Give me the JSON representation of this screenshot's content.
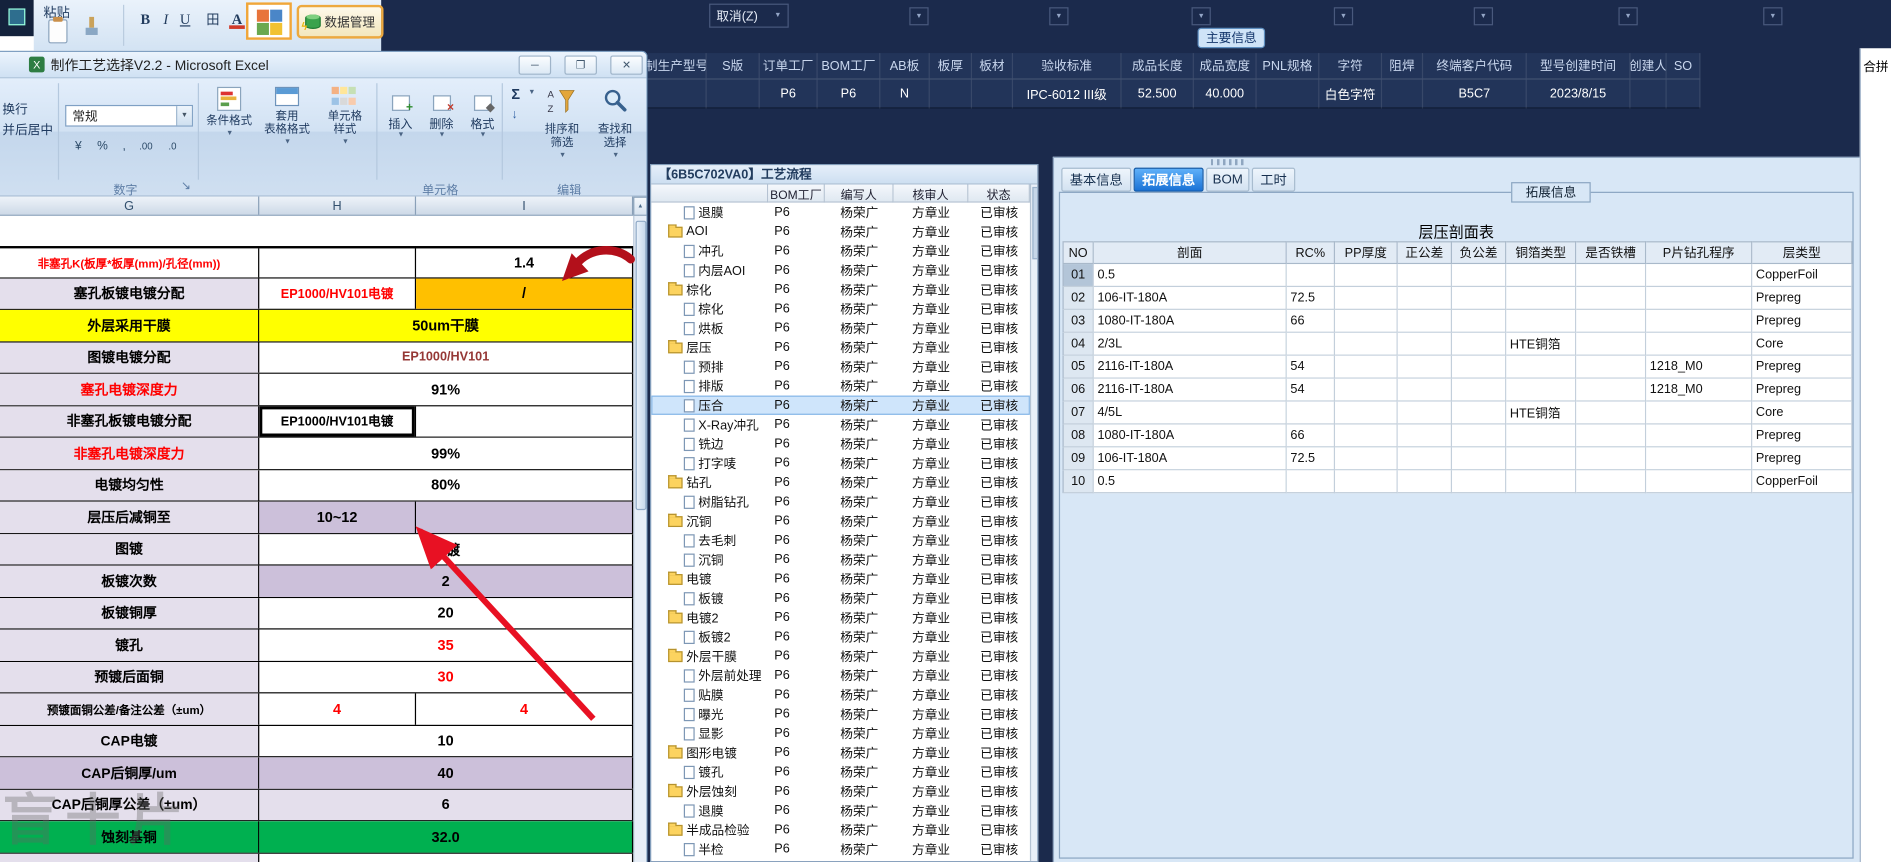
{
  "top_bar": {
    "paste": "粘贴",
    "bold": "B",
    "italic": "I",
    "underline": "U",
    "borders_icon": "田",
    "font_color_letter": "A",
    "data_management": "数据管理",
    "cancel_menu": "取消(Z)"
  },
  "header": {
    "tag": "主要信息",
    "merge_label": "合拼",
    "columns": [
      {
        "label": "制生产型号",
        "value": ""
      },
      {
        "label": "S版",
        "value": ""
      },
      {
        "label": "订单工厂",
        "value": "P6"
      },
      {
        "label": "BOM工厂",
        "value": "P6"
      },
      {
        "label": "AB板",
        "value": "N"
      },
      {
        "label": "板厚",
        "value": ""
      },
      {
        "label": "板材",
        "value": ""
      },
      {
        "label": "验收标准",
        "value": "IPC-6012 III级"
      },
      {
        "label": "成品长度",
        "value": "52.500"
      },
      {
        "label": "成品宽度",
        "value": "40.000"
      },
      {
        "label": "PNL规格",
        "value": ""
      },
      {
        "label": "字符",
        "value": "白色字符"
      },
      {
        "label": "阻焊",
        "value": ""
      },
      {
        "label": "终端客户代码",
        "value": "B5C7"
      },
      {
        "label": "型号创建时间",
        "value": "2023/8/15"
      },
      {
        "label": "创建人",
        "value": ""
      },
      {
        "label": "SO",
        "value": ""
      }
    ]
  },
  "excel": {
    "title": "制作工艺选择V2.2 - Microsoft Excel",
    "window_controls": {
      "min": "─",
      "max": "❐",
      "close": "✕",
      "help": "?"
    },
    "ribbon": {
      "wrap_fragment": "换行",
      "merge_center_fragment": "并后居中",
      "number_format_value": "常规",
      "number_buttons": [
        "¥",
        "%",
        ",",
        ".00",
        ".0"
      ],
      "number_group": "数字",
      "conditional_format": "条件格式",
      "format_as_table": [
        "套用",
        "表格格式"
      ],
      "cell_styles": [
        "单元格",
        "样式"
      ],
      "styles_group": "样式",
      "insert": "插入",
      "delete_label": "删除",
      "format_label": "格式",
      "cells_group": "单元格",
      "autosum": "Σ",
      "sort_filter": [
        "排序和",
        "筛选"
      ],
      "find_select": [
        "查找和",
        "选择"
      ],
      "edit_group": "编辑"
    },
    "sheet": {
      "col_headers": [
        "G",
        "H",
        "I"
      ],
      "rows": [
        {
          "label": "非塞孔K(板厚*板厚(mm)/孔径(mm))",
          "label_bg": "#ffffff",
          "label_color": "#ff0000",
          "label_small": true,
          "cells": [
            {
              "col": "H",
              "text": ""
            },
            {
              "col": "I",
              "text": "1.4"
            }
          ]
        },
        {
          "label": "塞孔板镀电镀分配",
          "label_bg": "#e4dfec",
          "cells": [
            {
              "col": "H",
              "text": "EP1000/HV101电镀",
              "color": "#ff0000"
            },
            {
              "col": "I",
              "text": "/",
              "bg": "#ffc000"
            }
          ]
        },
        {
          "label": "外层采用干膜",
          "label_bg": "#ffff00",
          "cells": [
            {
              "col": "HI",
              "text": "50um干膜",
              "bg": "#ffff00"
            }
          ]
        },
        {
          "label": "图镀电镀分配",
          "label_bg": "#e4dfec",
          "cells": [
            {
              "col": "HI",
              "text": "EP1000/HV101",
              "color": "#953735"
            }
          ]
        },
        {
          "label": "塞孔电镀深度力",
          "label_bg": "#e4dfec",
          "label_color": "#ff0000",
          "cells": [
            {
              "col": "HI",
              "text": "91%"
            }
          ]
        },
        {
          "label": "非塞孔板镀电镀分配",
          "label_bg": "#e4dfec",
          "cells": [
            {
              "col": "H",
              "text": "EP1000/HV101电镀",
              "selected": true
            },
            {
              "col": "I",
              "text": ""
            }
          ]
        },
        {
          "label": "非塞孔电镀深度力",
          "label_bg": "#e4dfec",
          "label_color": "#ff0000",
          "cells": [
            {
              "col": "HI",
              "text": "99%"
            }
          ]
        },
        {
          "label": "电镀均匀性",
          "label_bg": "#e4dfec",
          "cells": [
            {
              "col": "HI",
              "text": "80%"
            }
          ]
        },
        {
          "label": "层压后减铜至",
          "label_bg": "#e4dfec",
          "cells": [
            {
              "col": "H",
              "text": "10~12",
              "bg": "#ccc0da"
            },
            {
              "col": "I",
              "text": "",
              "bg": "#ccc0da"
            }
          ]
        },
        {
          "label": "图镀",
          "label_bg": "#e4dfec",
          "cells": [
            {
              "col": "HI",
              "text": "图镀"
            }
          ]
        },
        {
          "label": "板镀次数",
          "label_bg": "#e4dfec",
          "cells": [
            {
              "col": "HI",
              "text": "2",
              "bg": "#ccc0da"
            }
          ]
        },
        {
          "label": "板镀铜厚",
          "label_bg": "#e4dfec",
          "cells": [
            {
              "col": "HI",
              "text": "20"
            }
          ]
        },
        {
          "label": "镀孔",
          "label_bg": "#e4dfec",
          "cells": [
            {
              "col": "HI",
              "text": "35",
              "color": "#ff0000"
            }
          ]
        },
        {
          "label": "预镀后面铜",
          "label_bg": "#e4dfec",
          "cells": [
            {
              "col": "HI",
              "text": "30",
              "color": "#ff0000"
            }
          ]
        },
        {
          "label": "预镀面铜公差/备注公差（±um）",
          "label_bg": "#e4dfec",
          "label_small": true,
          "cells": [
            {
              "col": "H",
              "text": "4",
              "color": "#ff0000"
            },
            {
              "col": "I",
              "text": "4",
              "color": "#ff0000"
            }
          ]
        },
        {
          "label": "CAP电镀",
          "label_bg": "#e4dfec",
          "cells": [
            {
              "col": "HI",
              "text": "10"
            }
          ]
        },
        {
          "label": "CAP后铜厚/um",
          "label_bg": "#ccc0da",
          "cells": [
            {
              "col": "HI",
              "text": "40",
              "bg": "#ccc0da"
            }
          ]
        },
        {
          "label": "CAP后铜厚公差（±um）",
          "label_bg": "#e4dfec",
          "cells": [
            {
              "col": "HI",
              "text": "6",
              "bg": "#e4dfec"
            }
          ]
        },
        {
          "label": "蚀刻基铜",
          "label_bg": "#00b050",
          "cells": [
            {
              "col": "HI",
              "text": "32.0",
              "bg": "#00b050"
            }
          ]
        }
      ]
    }
  },
  "tree": {
    "title": "【6B5C702VA0】工艺流程",
    "headers": [
      "BOM工厂",
      "编写人",
      "核审人",
      "状态"
    ],
    "common": {
      "bom": "P6",
      "writer": "杨荣广",
      "reviewer": "方章业",
      "status": "已审核"
    },
    "items": [
      {
        "name": "退膜",
        "type": "leaf"
      },
      {
        "name": "AOI",
        "type": "folder"
      },
      {
        "name": "冲孔",
        "type": "leaf"
      },
      {
        "name": "内层AOI",
        "type": "leaf"
      },
      {
        "name": "棕化",
        "type": "folder"
      },
      {
        "name": "棕化",
        "type": "leaf"
      },
      {
        "name": "烘板",
        "type": "leaf"
      },
      {
        "name": "层压",
        "type": "folder"
      },
      {
        "name": "预排",
        "type": "leaf"
      },
      {
        "name": "排版",
        "type": "leaf"
      },
      {
        "name": "压合",
        "type": "leaf",
        "selected": true
      },
      {
        "name": "X-Ray冲孔",
        "type": "leaf"
      },
      {
        "name": "铣边",
        "type": "leaf"
      },
      {
        "name": "打字唛",
        "type": "leaf"
      },
      {
        "name": "钻孔",
        "type": "folder"
      },
      {
        "name": "树脂钻孔",
        "type": "leaf"
      },
      {
        "name": "沉铜",
        "type": "folder"
      },
      {
        "name": "去毛刺",
        "type": "leaf"
      },
      {
        "name": "沉铜",
        "type": "leaf"
      },
      {
        "name": "电镀",
        "type": "folder"
      },
      {
        "name": "板镀",
        "type": "leaf"
      },
      {
        "name": "电镀2",
        "type": "folder"
      },
      {
        "name": "板镀2",
        "type": "leaf"
      },
      {
        "name": "外层干膜",
        "type": "folder"
      },
      {
        "name": "外层前处理",
        "type": "leaf"
      },
      {
        "name": "贴膜",
        "type": "leaf"
      },
      {
        "name": "曝光",
        "type": "leaf"
      },
      {
        "name": "显影",
        "type": "leaf"
      },
      {
        "name": "图形电镀",
        "type": "folder"
      },
      {
        "name": "镀孔",
        "type": "leaf"
      },
      {
        "name": "外层蚀刻",
        "type": "folder"
      },
      {
        "name": "退膜",
        "type": "leaf"
      },
      {
        "name": "半成品检验",
        "type": "folder"
      },
      {
        "name": "半检",
        "type": "leaf"
      }
    ]
  },
  "panel": {
    "tabs": [
      "基本信息",
      "拓展信息",
      "BOM",
      "工时"
    ],
    "active_tab": 1,
    "group_label": "拓展信息",
    "table_title": "层压剖面表",
    "table": {
      "columns": [
        "NO",
        "剖面",
        "RC%",
        "PP厚度",
        "正公差",
        "负公差",
        "铜箔类型",
        "是否铁槽",
        "P片钻孔程序",
        "层类型"
      ],
      "rows": [
        [
          "01",
          "0.5",
          "",
          "",
          "",
          "",
          "",
          "",
          "",
          "CopperFoil"
        ],
        [
          "02",
          "106-IT-180A",
          "72.5",
          "",
          "",
          "",
          "",
          "",
          "",
          "Prepreg"
        ],
        [
          "03",
          "1080-IT-180A",
          "66",
          "",
          "",
          "",
          "",
          "",
          "",
          "Prepreg"
        ],
        [
          "04",
          "2/3L",
          "",
          "",
          "",
          "",
          "HTE铜箔",
          "",
          "",
          "Core"
        ],
        [
          "05",
          "2116-IT-180A",
          "54",
          "",
          "",
          "",
          "",
          "",
          "1218_M0",
          "Prepreg"
        ],
        [
          "06",
          "2116-IT-180A",
          "54",
          "",
          "",
          "",
          "",
          "",
          "1218_M0",
          "Prepreg"
        ],
        [
          "07",
          "4/5L",
          "",
          "",
          "",
          "",
          "HTE铜箔",
          "",
          "",
          "Core"
        ],
        [
          "08",
          "1080-IT-180A",
          "66",
          "",
          "",
          "",
          "",
          "",
          "",
          "Prepreg"
        ],
        [
          "09",
          "106-IT-180A",
          "72.5",
          "",
          "",
          "",
          "",
          "",
          "",
          "Prepreg"
        ],
        [
          "10",
          "0.5",
          "",
          "",
          "",
          "",
          "",
          "",
          "",
          "CopperFoil"
        ]
      ]
    }
  },
  "watermark": "盲十片",
  "annotations": {
    "straight_arrow_color": "#e81123",
    "curved_arrow_color": "#b3101b"
  }
}
